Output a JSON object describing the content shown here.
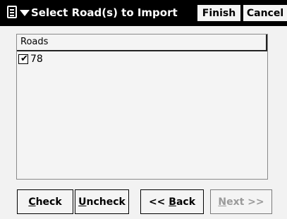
{
  "titlebar": {
    "title": "Select Road(s) to Import",
    "start_icon": "start-menu-icon",
    "finish_label": "Finish",
    "cancel_label": "Cancel"
  },
  "list": {
    "header": "Roads",
    "items": [
      {
        "label": "78",
        "checked": true
      }
    ]
  },
  "buttons": {
    "check": {
      "mnemonic": "C",
      "rest": "heck"
    },
    "uncheck": {
      "mnemonic": "U",
      "rest": "ncheck"
    },
    "back": {
      "prefix": "<< ",
      "mnemonic": "B",
      "rest": "ack"
    },
    "next": {
      "mnemonic": "N",
      "rest": "ext >>",
      "enabled": false
    }
  },
  "colors": {
    "titlebar_bg": "#000000",
    "window_bg": "#f2f2f2",
    "disabled_text": "#9a9a9a"
  }
}
